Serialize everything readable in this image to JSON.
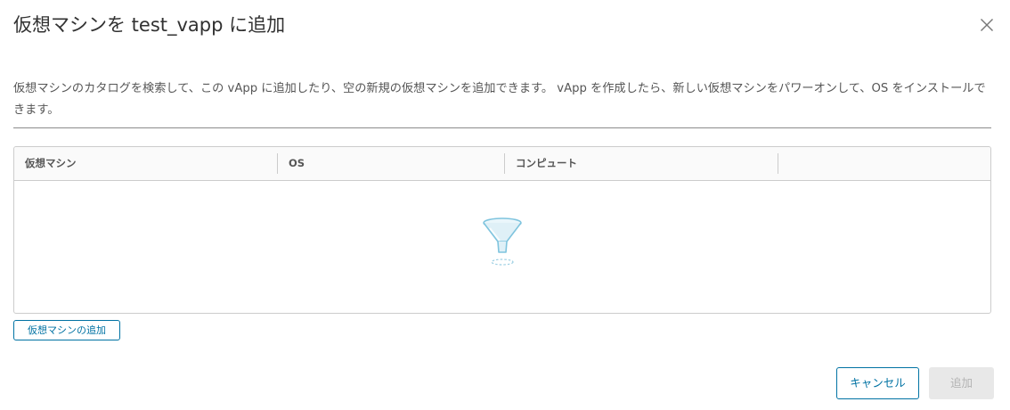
{
  "dialog": {
    "title": "仮想マシンを test_vapp に追加",
    "close_icon": "close-icon",
    "description": "仮想マシンのカタログを検索して、この vApp に追加したり、空の新規の仮想マシンを追加できます。 vApp を作成したら、新しい仮想マシンをパワーオンして、OS をインストールできます。"
  },
  "grid": {
    "columns": [
      "仮想マシン",
      "OS",
      "コンピュート",
      ""
    ],
    "rows": [],
    "empty_icon": "funnel-filter-icon"
  },
  "actions": {
    "add_vm_label": "仮想マシンの追加",
    "cancel_label": "キャンセル",
    "add_label": "追加"
  },
  "colors": {
    "accent": "#0072a3",
    "disabled_bg": "#e8e8e8",
    "disabled_text": "#b3b3b3",
    "border": "#cccccc",
    "header_bg": "#fafafa"
  }
}
